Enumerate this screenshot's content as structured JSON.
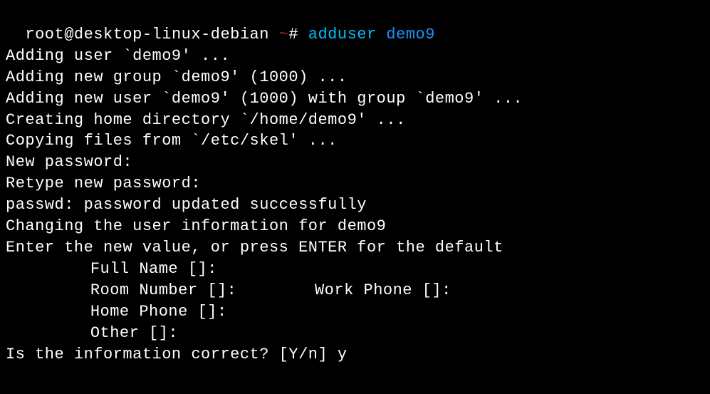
{
  "prompt": {
    "user_host": "root@desktop-linux-debian ",
    "tilde": "~",
    "hash": "# ",
    "command": "adduser ",
    "argument": "demo9"
  },
  "output": {
    "l1": "Adding user `demo9' ...",
    "l2": "Adding new group `demo9' (1000) ...",
    "l3": "Adding new user `demo9' (1000) with group `demo9' ...",
    "l4": "Creating home directory `/home/demo9' ...",
    "l5": "Copying files from `/etc/skel' ...",
    "l6": "New password:",
    "l7": "Retype new password:",
    "l8": "passwd: password updated successfully",
    "l9": "Changing the user information for demo9",
    "l10": "Enter the new value, or press ENTER for the default",
    "full_name": "Full Name []:",
    "blank": "",
    "room_number": "Room Number []:",
    "work_phone": "Work Phone []:",
    "home_phone": "Home Phone []:",
    "other": "Other []:",
    "confirm": "Is the information correct? [Y/n] y"
  }
}
